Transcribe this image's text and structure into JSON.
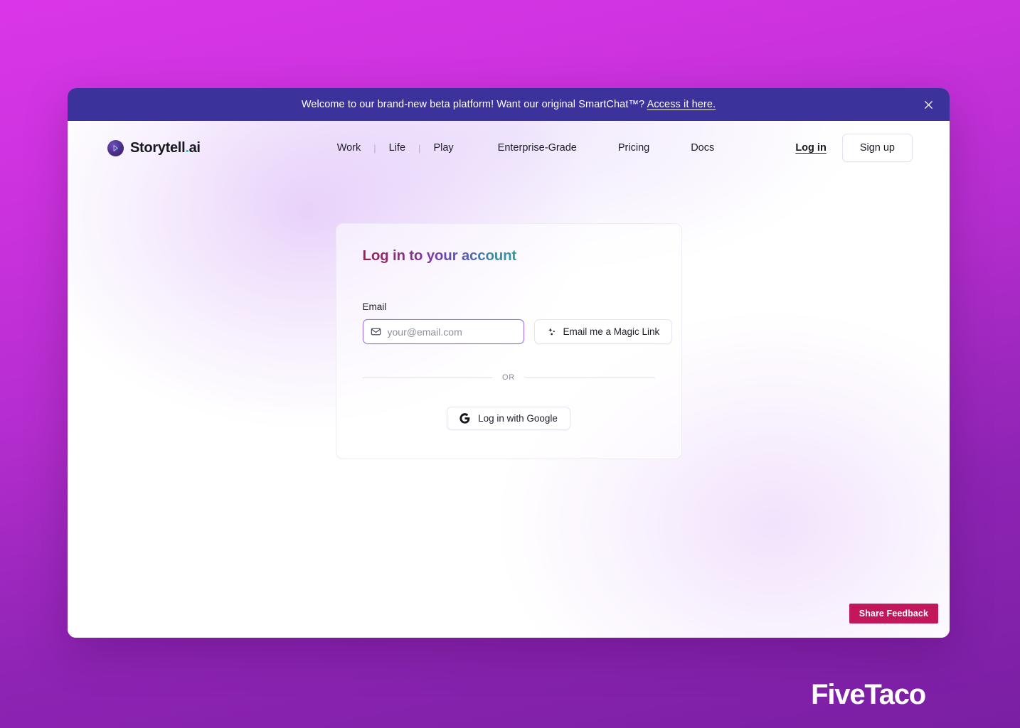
{
  "banner": {
    "text_before": "Welcome to our brand-new beta platform! Want our original SmartChat™? ",
    "link_text": "Access it here.",
    "close_icon": "close-icon",
    "bg_color": "#3b339b"
  },
  "navbar": {
    "brand": {
      "name": "Storytell",
      "dot": ".",
      "tld": "ai",
      "logo_icon": "storytell-play-logo-icon",
      "dot_color": "#19c6d6"
    },
    "links": [
      {
        "label": "Work"
      },
      {
        "label": "Life"
      },
      {
        "label": "Play"
      },
      {
        "label": "Enterprise-Grade"
      },
      {
        "label": "Pricing"
      },
      {
        "label": "Docs"
      }
    ],
    "separator": "|",
    "login_label": "Log in",
    "signup_label": "Sign up"
  },
  "login_card": {
    "title": "Log in to your account",
    "title_gradient_from": "#9b2350",
    "title_gradient_mid": "#7b3ca6",
    "title_gradient_to": "#2f9aa0",
    "email_label": "Email",
    "email_value": "",
    "email_placeholder": "your@email.com",
    "email_icon": "envelope-icon",
    "focus_border_color": "#9b6ef0",
    "magic_link_label": "Email me a Magic Link",
    "magic_link_icon": "sparkles-icon",
    "divider_label": "OR",
    "google_label": "Log in with Google",
    "google_icon": "google-g-icon"
  },
  "footer": {
    "share_feedback_label": "Share Feedback",
    "share_feedback_color": "#c2185b"
  },
  "watermark": {
    "text": "FiveTaco"
  }
}
